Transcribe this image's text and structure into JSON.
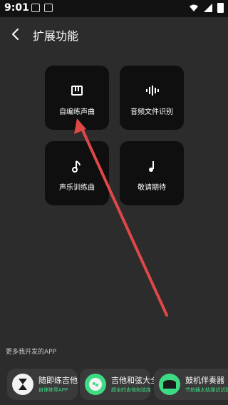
{
  "status_bar": {
    "time": "9:01",
    "icons": [
      "sim-icon",
      "image-icon",
      "wifi-icon",
      "signal-icon",
      "battery-icon"
    ]
  },
  "header": {
    "title": "扩展功能",
    "back_icon": "back-arrow-icon"
  },
  "tiles": [
    {
      "label": "自编练声曲",
      "icon": "piano-icon"
    },
    {
      "label": "音频文件识别",
      "icon": "waveform-icon"
    },
    {
      "label": "声乐训练曲",
      "icon": "music-note-icon"
    },
    {
      "label": "敬请期待",
      "icon": "single-note-icon"
    }
  ],
  "more_apps": {
    "title": "更多我开发的APP",
    "apps": [
      {
        "name": "随即练吉他",
        "subtitle": "自律练琴APP"
      },
      {
        "name": "吉他和弦大全",
        "subtitle": "超全的吉他和弦库"
      },
      {
        "name": "鼓机伴奏器",
        "subtitle": "节拍器太枯燥试试鼓机"
      }
    ]
  },
  "annotation": {
    "type": "red-arrow",
    "color": "#e04848"
  }
}
